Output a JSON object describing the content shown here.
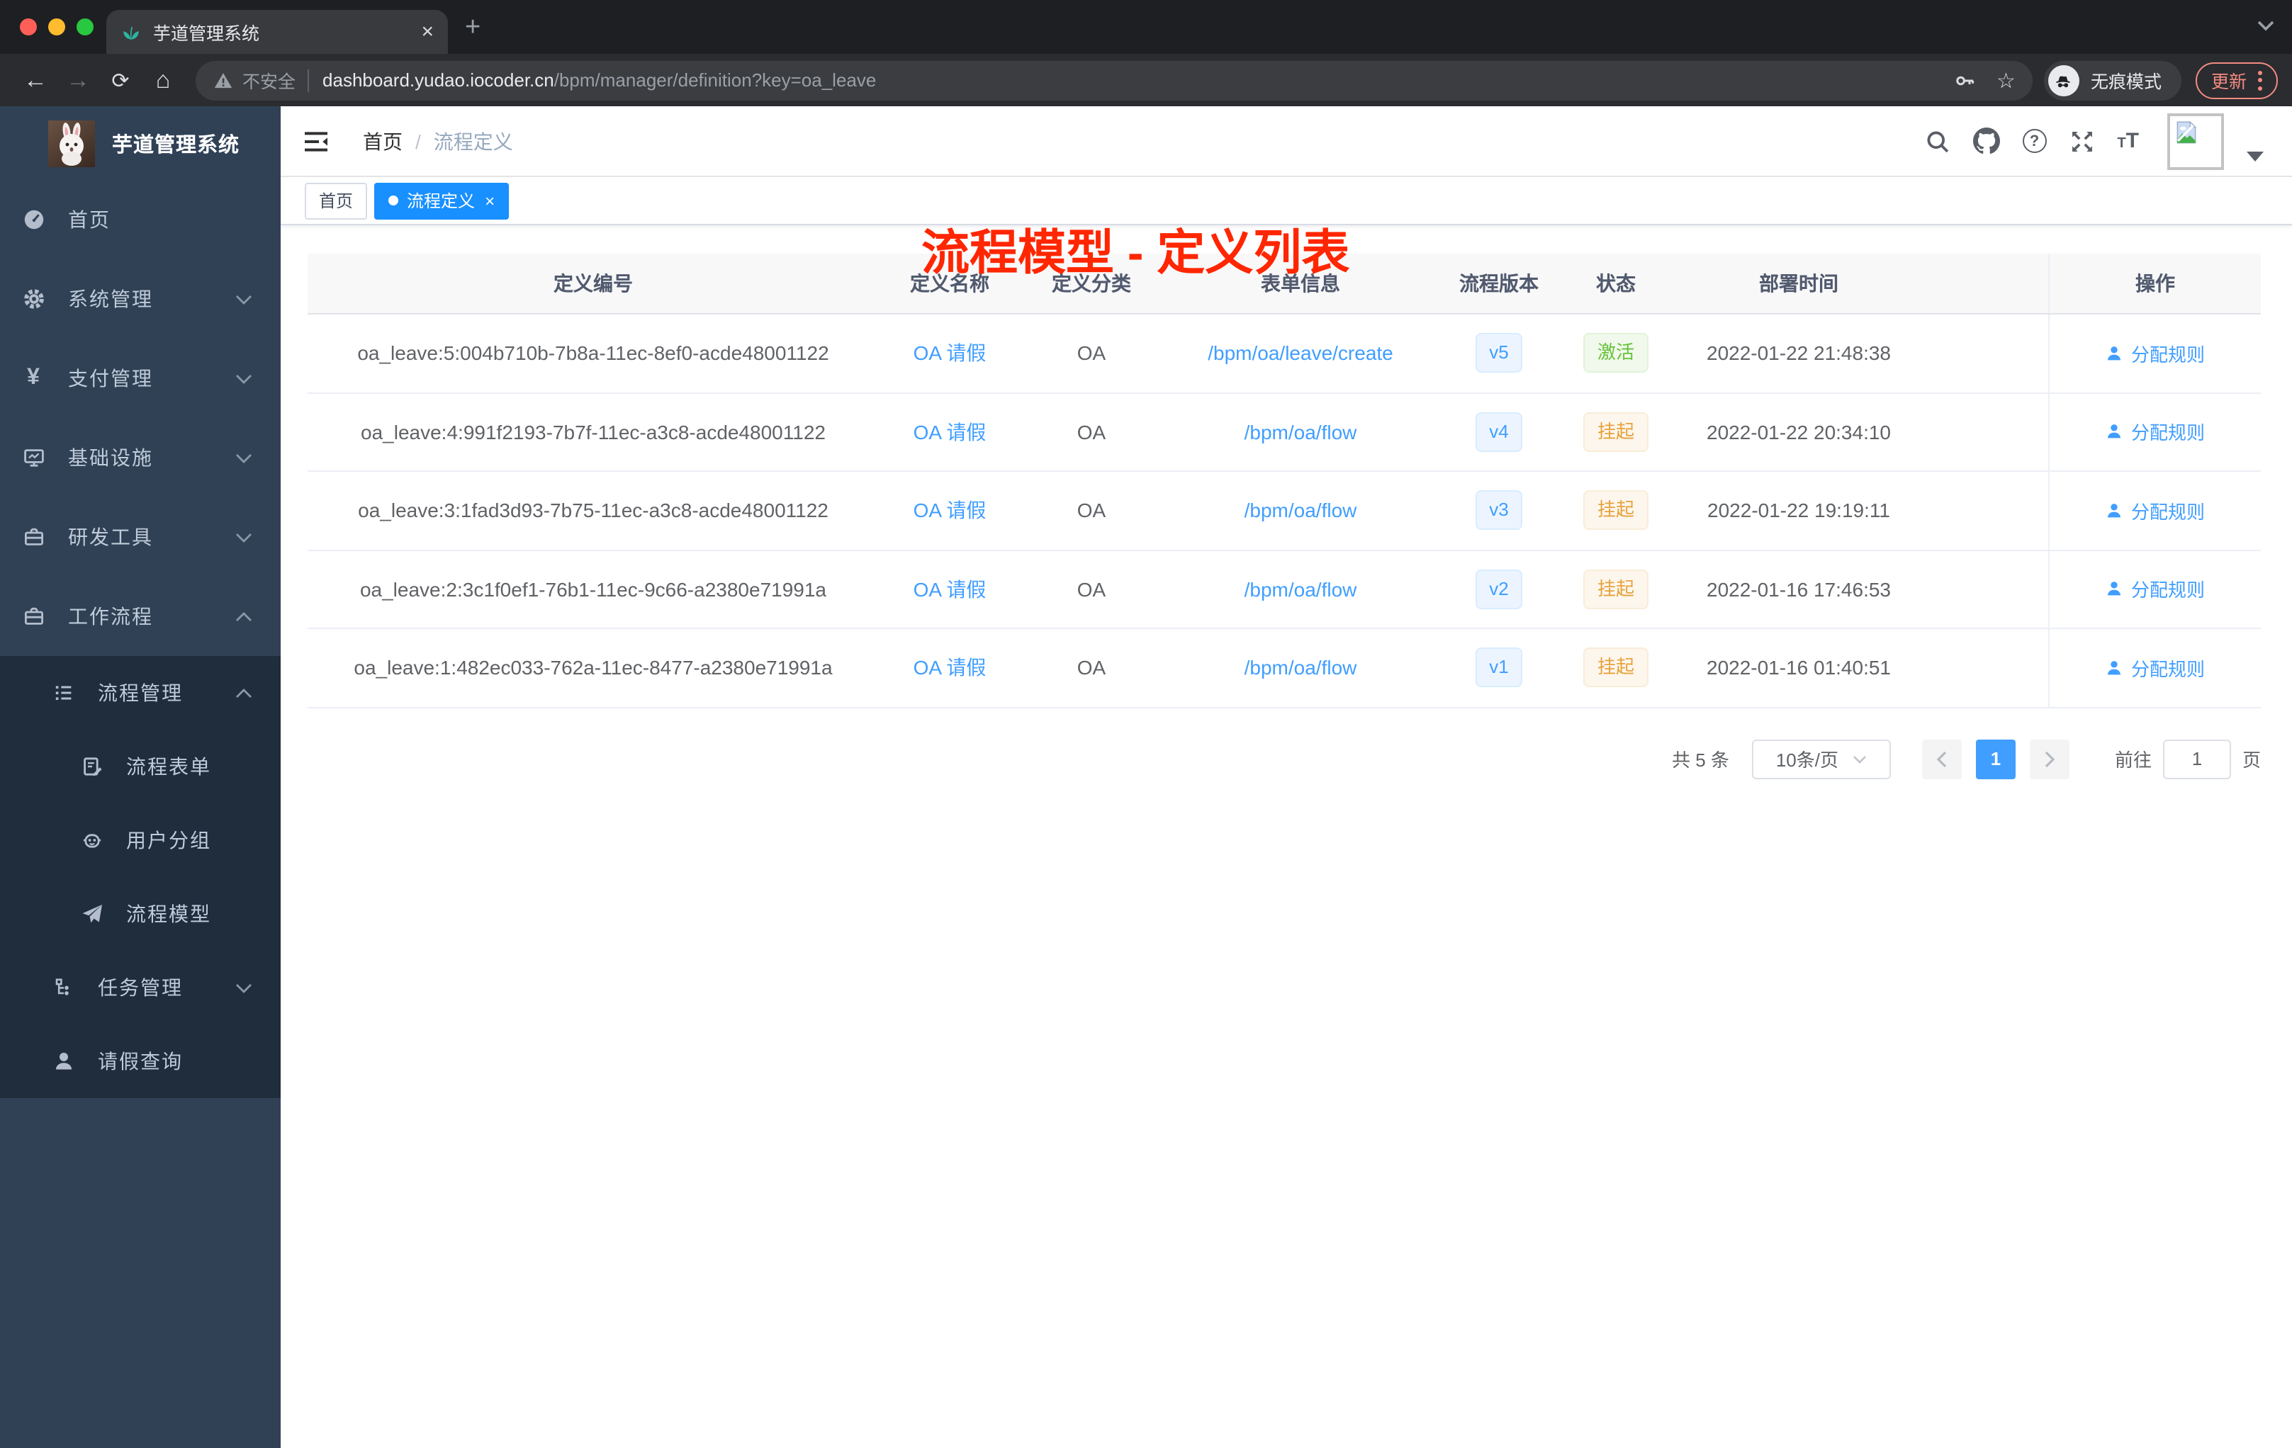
{
  "browser": {
    "tab_title": "芋道管理系统",
    "tab_close_glyph": "×",
    "new_tab_glyph": "+",
    "back_glyph": "←",
    "forward_glyph": "→",
    "reload_glyph": "⟳",
    "home_glyph": "⌂",
    "security_text": "不安全",
    "url_host": "dashboard.yudao.iocoder.cn",
    "url_path": "/bpm/manager/definition?key=oa_leave",
    "star_glyph": "☆",
    "incognito_label": "无痕模式",
    "update_label": "更新"
  },
  "sidebar": {
    "logo_title": "芋道管理系统",
    "items": [
      {
        "label": "首页"
      },
      {
        "label": "系统管理"
      },
      {
        "label": "支付管理"
      },
      {
        "label": "基础设施"
      },
      {
        "label": "研发工具"
      },
      {
        "label": "工作流程"
      },
      {
        "label": "流程管理"
      },
      {
        "label": "流程表单"
      },
      {
        "label": "用户分组"
      },
      {
        "label": "流程模型"
      },
      {
        "label": "任务管理"
      },
      {
        "label": "请假查询"
      }
    ],
    "yen_glyph": "¥"
  },
  "navbar": {
    "breadcrumb": {
      "home": "首页",
      "separator": "/",
      "current": "流程定义"
    },
    "annotation": "流程模型 - 定义列表"
  },
  "tags_view": {
    "tags": [
      {
        "label": "首页",
        "active": false
      },
      {
        "label": "流程定义",
        "active": true,
        "close_glyph": "×"
      }
    ]
  },
  "table": {
    "columns": [
      "定义编号",
      "定义名称",
      "定义分类",
      "表单信息",
      "流程版本",
      "状态",
      "部署时间",
      "操作"
    ],
    "rows": [
      {
        "id": "oa_leave:5:004b710b-7b8a-11ec-8ef0-acde48001122",
        "name": "OA 请假",
        "category": "OA",
        "form": "/bpm/oa/leave/create",
        "version": "v5",
        "status": "激活",
        "deploy_time": "2022-01-22 21:48:38",
        "action": "分配规则"
      },
      {
        "id": "oa_leave:4:991f2193-7b7f-11ec-a3c8-acde48001122",
        "name": "OA 请假",
        "category": "OA",
        "form": "/bpm/oa/flow",
        "version": "v4",
        "status": "挂起",
        "deploy_time": "2022-01-22 20:34:10",
        "action": "分配规则"
      },
      {
        "id": "oa_leave:3:1fad3d93-7b75-11ec-a3c8-acde48001122",
        "name": "OA 请假",
        "category": "OA",
        "form": "/bpm/oa/flow",
        "version": "v3",
        "status": "挂起",
        "deploy_time": "2022-01-22 19:19:11",
        "action": "分配规则"
      },
      {
        "id": "oa_leave:2:3c1f0ef1-76b1-11ec-9c66-a2380e71991a",
        "name": "OA 请假",
        "category": "OA",
        "form": "/bpm/oa/flow",
        "version": "v2",
        "status": "挂起",
        "deploy_time": "2022-01-16 17:46:53",
        "action": "分配规则"
      },
      {
        "id": "oa_leave:1:482ec033-762a-11ec-8477-a2380e71991a",
        "name": "OA 请假",
        "category": "OA",
        "form": "/bpm/oa/flow",
        "version": "v1",
        "status": "挂起",
        "deploy_time": "2022-01-16 01:40:51",
        "action": "分配规则"
      }
    ]
  },
  "pagination": {
    "total": "共 5 条",
    "page_size": "10条/页",
    "current_page": "1",
    "goto_label": "前往",
    "goto_value": "1",
    "page_unit": "页"
  },
  "colors": {
    "accent": "#409eff",
    "active_tag": "#1890ff",
    "success": "#67c23a",
    "warning": "#e6a23c",
    "annotation_red": "#ff2600",
    "sidebar_bg": "#304156",
    "submenu_bg": "#1f2d3d"
  }
}
